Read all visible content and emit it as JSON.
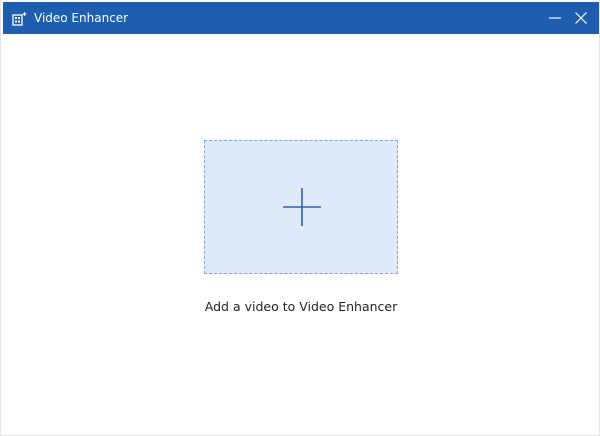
{
  "window": {
    "title": "Video Enhancer",
    "app_icon": "video-enhancer-app-icon",
    "controls": {
      "minimize_icon": "minimize-icon",
      "close_icon": "close-icon"
    }
  },
  "main": {
    "dropzone": {
      "icon": "plus-icon",
      "caption": "Add a video to Video Enhancer"
    }
  },
  "colors": {
    "titlebar": "#1f5eae",
    "dropzone_fill": "#dfeafb",
    "dropzone_border": "#7ea4d8",
    "plus": "#2d63ad"
  }
}
